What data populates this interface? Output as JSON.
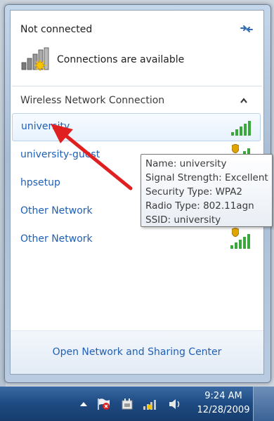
{
  "flyout": {
    "status_title": "Not connected",
    "connections_available": "Connections are available",
    "section_title": "Wireless Network Connection",
    "networks": [
      {
        "name": "university",
        "secured": false,
        "signal": 5,
        "selected": true
      },
      {
        "name": "university-guest",
        "secured": true,
        "signal": 5,
        "selected": false
      },
      {
        "name": "hpsetup",
        "secured": false,
        "signal": 4,
        "selected": false
      },
      {
        "name": "Other Network",
        "secured": false,
        "signal": 4,
        "selected": false
      },
      {
        "name": "Other Network",
        "secured": true,
        "signal": 5,
        "selected": false
      }
    ],
    "footer_link": "Open Network and Sharing Center"
  },
  "tooltip": {
    "name": "Name: university",
    "signal_strength": "Signal Strength: Excellent",
    "security_type": "Security Type: WPA2",
    "radio_type": "Radio Type: 802.11agn",
    "ssid": "SSID: university"
  },
  "taskbar": {
    "time": "9:24 AM",
    "date": "12/28/2009"
  },
  "colors": {
    "link": "#1f5fb5",
    "signal_green": "#3aa83a",
    "taskbar": "#1f4c84",
    "annotation_arrow": "#e02020"
  }
}
